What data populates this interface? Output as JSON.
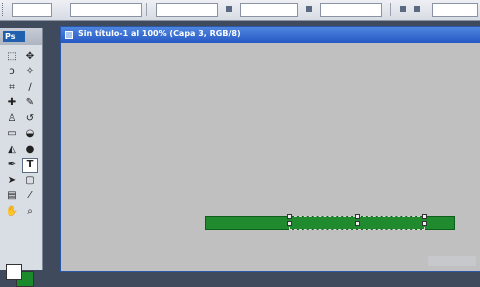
{
  "app": {
    "logo_text": "Ps"
  },
  "document": {
    "title": "Sin título-1 al 100% (Capa 3, RGB/8)"
  },
  "tools": [
    {
      "name": "marquee-tool-icon",
      "glyph": "⬚"
    },
    {
      "name": "move-tool-icon",
      "glyph": "✥"
    },
    {
      "name": "lasso-tool-icon",
      "glyph": "ↄ"
    },
    {
      "name": "magic-wand-tool-icon",
      "glyph": "✧"
    },
    {
      "name": "crop-tool-icon",
      "glyph": "⌗"
    },
    {
      "name": "slice-tool-icon",
      "glyph": "∕"
    },
    {
      "name": "healing-brush-tool-icon",
      "glyph": "✚"
    },
    {
      "name": "brush-tool-icon",
      "glyph": "✎"
    },
    {
      "name": "clone-stamp-tool-icon",
      "glyph": "♙"
    },
    {
      "name": "history-brush-tool-icon",
      "glyph": "↺"
    },
    {
      "name": "eraser-tool-icon",
      "glyph": "▭"
    },
    {
      "name": "paint-bucket-tool-icon",
      "glyph": "◒"
    },
    {
      "name": "blur-tool-icon",
      "glyph": "◭"
    },
    {
      "name": "dodge-tool-icon",
      "glyph": "●"
    },
    {
      "name": "pen-tool-icon",
      "glyph": "✒"
    },
    {
      "name": "type-tool-icon",
      "glyph": "T"
    },
    {
      "name": "path-selection-tool-icon",
      "glyph": "➤"
    },
    {
      "name": "shape-tool-icon",
      "glyph": "▢"
    },
    {
      "name": "notes-tool-icon",
      "glyph": "▤"
    },
    {
      "name": "eyedropper-tool-icon",
      "glyph": "⁄"
    },
    {
      "name": "hand-tool-icon",
      "glyph": "✋"
    },
    {
      "name": "zoom-tool-icon",
      "glyph": "⌕"
    }
  ],
  "colors": {
    "foreground": "#ffffff",
    "background": "#1a8a2a",
    "shape_fill": "#1f8a2e"
  }
}
